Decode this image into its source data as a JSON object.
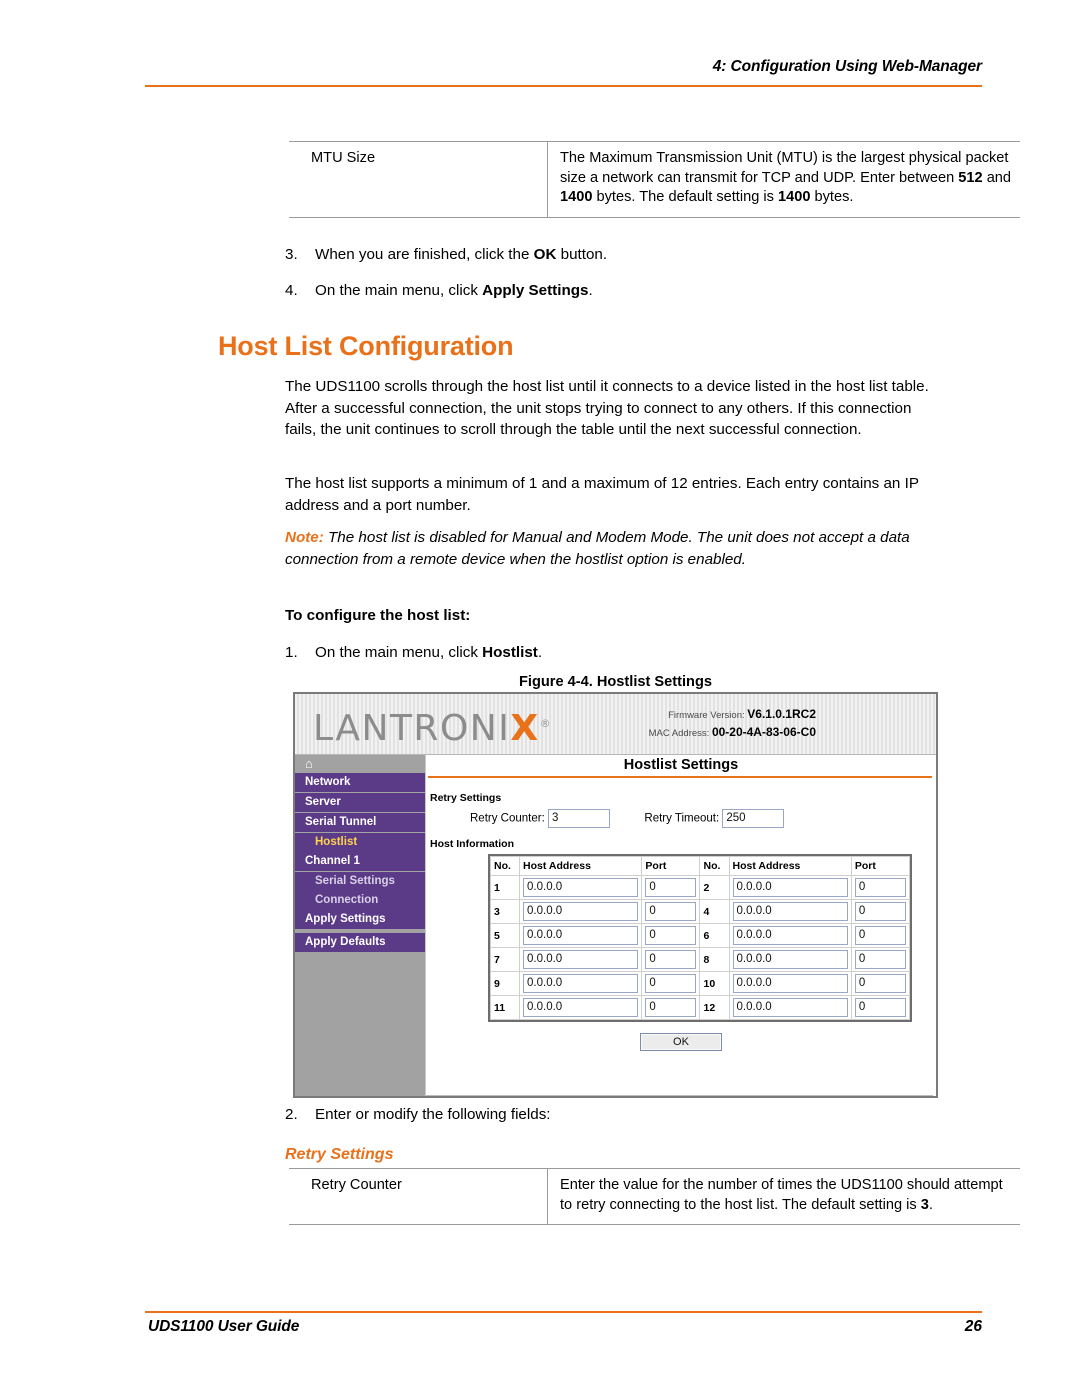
{
  "header": {
    "title": "4: Configuration Using Web-Manager"
  },
  "mtu_table": {
    "name": "MTU Size",
    "desc_pre": "The Maximum Transmission Unit (MTU) is the largest physical packet size a network can transmit for TCP and UDP. Enter between ",
    "bold_1": "512",
    "desc_mid": " and ",
    "bold_2": "1400",
    "desc_mid2": " bytes. The default setting is ",
    "bold_3": "1400",
    "desc_end": " bytes."
  },
  "steps": {
    "step3_num": "3.",
    "step3_pre": "When you are finished, click the ",
    "step3_bold": "OK",
    "step3_post": " button.",
    "step4_num": "4.",
    "step4_pre": "On the main menu, click ",
    "step4_bold": "Apply Settings",
    "step4_post": ".",
    "step1_num": "1.",
    "step1_pre": "On the main menu, click ",
    "step1_bold": "Hostlist",
    "step1_post": ".",
    "step2_num": "2.",
    "step2_text": "Enter or modify the following fields:"
  },
  "section": {
    "heading": "Host List Configuration",
    "para1": "The UDS1100 scrolls through the host list until it connects to a device listed in the host list table. After a successful connection, the unit stops trying to connect to any others. If this connection fails, the unit continues to scroll through the table until the next successful connection.",
    "para2": "The host list supports a minimum of 1 and a maximum of 12 entries. Each entry contains an IP address and a port number.",
    "note_lead": "Note:",
    "note_body": " The host list is disabled for Manual and Modem Mode. The unit does not accept a data connection from a remote device when the hostlist option is enabled.",
    "subhead": "To configure the host list:",
    "retry_subhead": "Retry Settings"
  },
  "figure": {
    "caption": "Figure 4-4. Hostlist Settings",
    "logo_main": "LANTRONI",
    "logo_x": "X",
    "logo_reg": "®",
    "firmware_label": "Firmware Version:",
    "firmware_value": "V6.1.0.1RC2",
    "mac_label": "MAC Address:",
    "mac_value": "00-20-4A-83-06-C0",
    "home_icon": "⌂",
    "nav": [
      {
        "label": "Network",
        "sub": false,
        "active": false
      },
      {
        "label": "Server",
        "sub": false,
        "active": false
      },
      {
        "label": "Serial Tunnel",
        "sub": false,
        "active": false
      },
      {
        "label": "Hostlist",
        "sub": true,
        "active": true
      },
      {
        "label": "Channel 1",
        "sub": false,
        "active": false
      },
      {
        "label": "Serial Settings",
        "sub": true,
        "active": false
      },
      {
        "label": "Connection",
        "sub": true,
        "active": false
      },
      {
        "label": "Apply Settings",
        "sub": false,
        "active": false
      },
      {
        "label": "Apply Defaults",
        "sub": false,
        "active": false
      }
    ],
    "page_title": "Hostlist Settings",
    "retry_section_label": "Retry Settings",
    "retry_counter_label": "Retry Counter:",
    "retry_counter_value": "3",
    "retry_timeout_label": "Retry Timeout:",
    "retry_timeout_value": "250",
    "host_section_label": "Host Information",
    "host_table": {
      "headers": [
        "No.",
        "Host Address",
        "Port",
        "No.",
        "Host Address",
        "Port"
      ],
      "rows": [
        {
          "no_a": "1",
          "addr_a": "0.0.0.0",
          "port_a": "0",
          "no_b": "2",
          "addr_b": "0.0.0.0",
          "port_b": "0"
        },
        {
          "no_a": "3",
          "addr_a": "0.0.0.0",
          "port_a": "0",
          "no_b": "4",
          "addr_b": "0.0.0.0",
          "port_b": "0"
        },
        {
          "no_a": "5",
          "addr_a": "0.0.0.0",
          "port_a": "0",
          "no_b": "6",
          "addr_b": "0.0.0.0",
          "port_b": "0"
        },
        {
          "no_a": "7",
          "addr_a": "0.0.0.0",
          "port_a": "0",
          "no_b": "8",
          "addr_b": "0.0.0.0",
          "port_b": "0"
        },
        {
          "no_a": "9",
          "addr_a": "0.0.0.0",
          "port_a": "0",
          "no_b": "10",
          "addr_b": "0.0.0.0",
          "port_b": "0"
        },
        {
          "no_a": "11",
          "addr_a": "0.0.0.0",
          "port_a": "0",
          "no_b": "12",
          "addr_b": "0.0.0.0",
          "port_b": "0"
        }
      ]
    },
    "ok_button": "OK"
  },
  "retry_table": {
    "name": "Retry Counter",
    "desc_pre": "Enter the value for the number of times the UDS1100 should attempt to retry connecting to the host list. The default setting is ",
    "bold_1": "3",
    "desc_end": "."
  },
  "footer": {
    "left": "UDS1100 User Guide",
    "page_number": "26"
  },
  "colors": {
    "accent_orange": "#E8711A",
    "nav_purple": "#5B3A88",
    "sidebar_gray": "#A2A2A2",
    "active_yellow": "#FFD34D"
  }
}
